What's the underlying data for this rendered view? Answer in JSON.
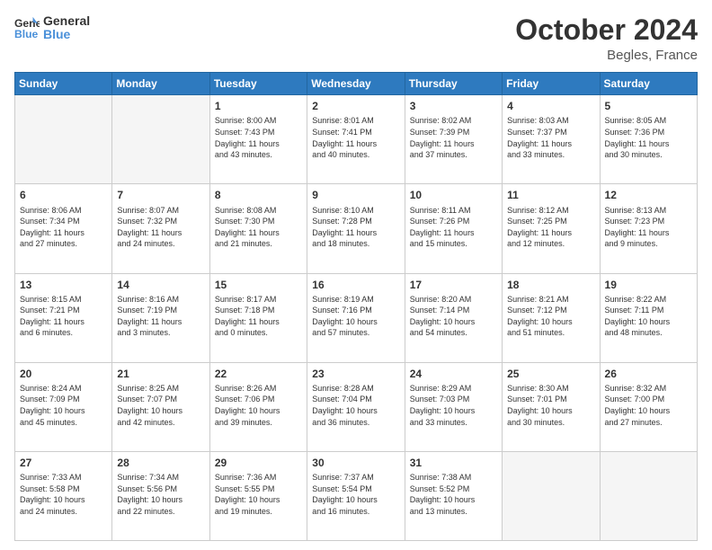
{
  "header": {
    "logo_line1": "General",
    "logo_line2": "Blue",
    "month_title": "October 2024",
    "location": "Begles, France"
  },
  "weekdays": [
    "Sunday",
    "Monday",
    "Tuesday",
    "Wednesday",
    "Thursday",
    "Friday",
    "Saturday"
  ],
  "weeks": [
    [
      {
        "day": "",
        "info": ""
      },
      {
        "day": "",
        "info": ""
      },
      {
        "day": "1",
        "info": "Sunrise: 8:00 AM\nSunset: 7:43 PM\nDaylight: 11 hours\nand 43 minutes."
      },
      {
        "day": "2",
        "info": "Sunrise: 8:01 AM\nSunset: 7:41 PM\nDaylight: 11 hours\nand 40 minutes."
      },
      {
        "day": "3",
        "info": "Sunrise: 8:02 AM\nSunset: 7:39 PM\nDaylight: 11 hours\nand 37 minutes."
      },
      {
        "day": "4",
        "info": "Sunrise: 8:03 AM\nSunset: 7:37 PM\nDaylight: 11 hours\nand 33 minutes."
      },
      {
        "day": "5",
        "info": "Sunrise: 8:05 AM\nSunset: 7:36 PM\nDaylight: 11 hours\nand 30 minutes."
      }
    ],
    [
      {
        "day": "6",
        "info": "Sunrise: 8:06 AM\nSunset: 7:34 PM\nDaylight: 11 hours\nand 27 minutes."
      },
      {
        "day": "7",
        "info": "Sunrise: 8:07 AM\nSunset: 7:32 PM\nDaylight: 11 hours\nand 24 minutes."
      },
      {
        "day": "8",
        "info": "Sunrise: 8:08 AM\nSunset: 7:30 PM\nDaylight: 11 hours\nand 21 minutes."
      },
      {
        "day": "9",
        "info": "Sunrise: 8:10 AM\nSunset: 7:28 PM\nDaylight: 11 hours\nand 18 minutes."
      },
      {
        "day": "10",
        "info": "Sunrise: 8:11 AM\nSunset: 7:26 PM\nDaylight: 11 hours\nand 15 minutes."
      },
      {
        "day": "11",
        "info": "Sunrise: 8:12 AM\nSunset: 7:25 PM\nDaylight: 11 hours\nand 12 minutes."
      },
      {
        "day": "12",
        "info": "Sunrise: 8:13 AM\nSunset: 7:23 PM\nDaylight: 11 hours\nand 9 minutes."
      }
    ],
    [
      {
        "day": "13",
        "info": "Sunrise: 8:15 AM\nSunset: 7:21 PM\nDaylight: 11 hours\nand 6 minutes."
      },
      {
        "day": "14",
        "info": "Sunrise: 8:16 AM\nSunset: 7:19 PM\nDaylight: 11 hours\nand 3 minutes."
      },
      {
        "day": "15",
        "info": "Sunrise: 8:17 AM\nSunset: 7:18 PM\nDaylight: 11 hours\nand 0 minutes."
      },
      {
        "day": "16",
        "info": "Sunrise: 8:19 AM\nSunset: 7:16 PM\nDaylight: 10 hours\nand 57 minutes."
      },
      {
        "day": "17",
        "info": "Sunrise: 8:20 AM\nSunset: 7:14 PM\nDaylight: 10 hours\nand 54 minutes."
      },
      {
        "day": "18",
        "info": "Sunrise: 8:21 AM\nSunset: 7:12 PM\nDaylight: 10 hours\nand 51 minutes."
      },
      {
        "day": "19",
        "info": "Sunrise: 8:22 AM\nSunset: 7:11 PM\nDaylight: 10 hours\nand 48 minutes."
      }
    ],
    [
      {
        "day": "20",
        "info": "Sunrise: 8:24 AM\nSunset: 7:09 PM\nDaylight: 10 hours\nand 45 minutes."
      },
      {
        "day": "21",
        "info": "Sunrise: 8:25 AM\nSunset: 7:07 PM\nDaylight: 10 hours\nand 42 minutes."
      },
      {
        "day": "22",
        "info": "Sunrise: 8:26 AM\nSunset: 7:06 PM\nDaylight: 10 hours\nand 39 minutes."
      },
      {
        "day": "23",
        "info": "Sunrise: 8:28 AM\nSunset: 7:04 PM\nDaylight: 10 hours\nand 36 minutes."
      },
      {
        "day": "24",
        "info": "Sunrise: 8:29 AM\nSunset: 7:03 PM\nDaylight: 10 hours\nand 33 minutes."
      },
      {
        "day": "25",
        "info": "Sunrise: 8:30 AM\nSunset: 7:01 PM\nDaylight: 10 hours\nand 30 minutes."
      },
      {
        "day": "26",
        "info": "Sunrise: 8:32 AM\nSunset: 7:00 PM\nDaylight: 10 hours\nand 27 minutes."
      }
    ],
    [
      {
        "day": "27",
        "info": "Sunrise: 7:33 AM\nSunset: 5:58 PM\nDaylight: 10 hours\nand 24 minutes."
      },
      {
        "day": "28",
        "info": "Sunrise: 7:34 AM\nSunset: 5:56 PM\nDaylight: 10 hours\nand 22 minutes."
      },
      {
        "day": "29",
        "info": "Sunrise: 7:36 AM\nSunset: 5:55 PM\nDaylight: 10 hours\nand 19 minutes."
      },
      {
        "day": "30",
        "info": "Sunrise: 7:37 AM\nSunset: 5:54 PM\nDaylight: 10 hours\nand 16 minutes."
      },
      {
        "day": "31",
        "info": "Sunrise: 7:38 AM\nSunset: 5:52 PM\nDaylight: 10 hours\nand 13 minutes."
      },
      {
        "day": "",
        "info": ""
      },
      {
        "day": "",
        "info": ""
      }
    ]
  ]
}
